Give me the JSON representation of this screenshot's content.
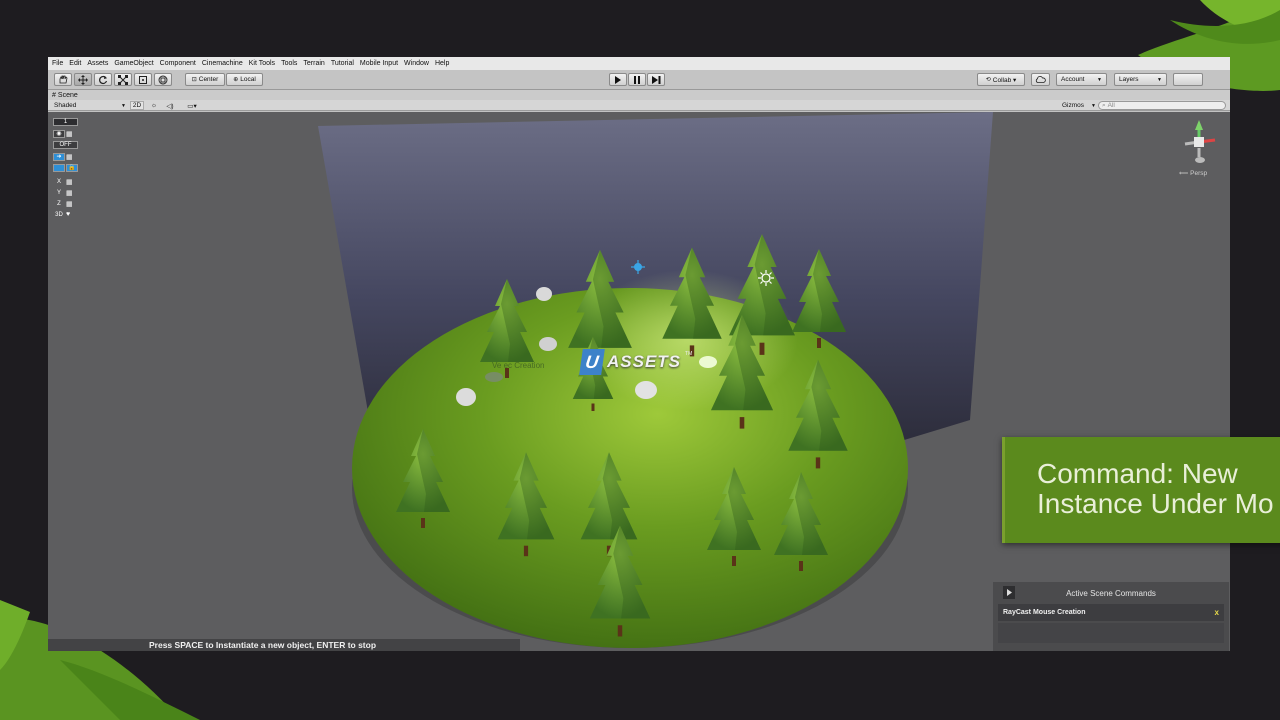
{
  "menu": [
    "File",
    "Edit",
    "Assets",
    "GameObject",
    "Component",
    "Cinemachine",
    "Kit Tools",
    "Tools",
    "Terrain",
    "Tutorial",
    "Mobile Input",
    "Window",
    "Help"
  ],
  "toolbar": {
    "pivot_label": "Center",
    "space_label": "Local",
    "collab_label": "Collab ▾",
    "account_label": "Account",
    "layers_label": "Layers"
  },
  "scene": {
    "tab_label": "Scene",
    "shading_mode": "Shaded",
    "mode_2d": "2D",
    "gizmos_label": "Gizmos",
    "search_placeholder": "All",
    "persp_label": "Persp"
  },
  "gizmo_panel": {
    "level": "1",
    "off": "OFF",
    "axes": [
      "X",
      "Y",
      "Z"
    ],
    "mode_3d": "3D"
  },
  "scene_text": {
    "logo_letter": "U",
    "logo_word": "ASSETS",
    "logo_sup": "TM",
    "ghost_label": "Ve ec Creation"
  },
  "status": {
    "message": "Press SPACE to Instantiate a new object, ENTER to stop"
  },
  "command_panel": {
    "title": "Active Scene Commands",
    "command": "RayCast Mouse Creation",
    "close": "x"
  },
  "banner": {
    "line1": "Command: New",
    "line2": "Instance Under Mo"
  },
  "colors": {
    "banner_green": "#5b8a1d",
    "ground_green": "#5f8f1a",
    "backdrop": "#4a4c66",
    "close_yellow": "#e6d84a"
  }
}
